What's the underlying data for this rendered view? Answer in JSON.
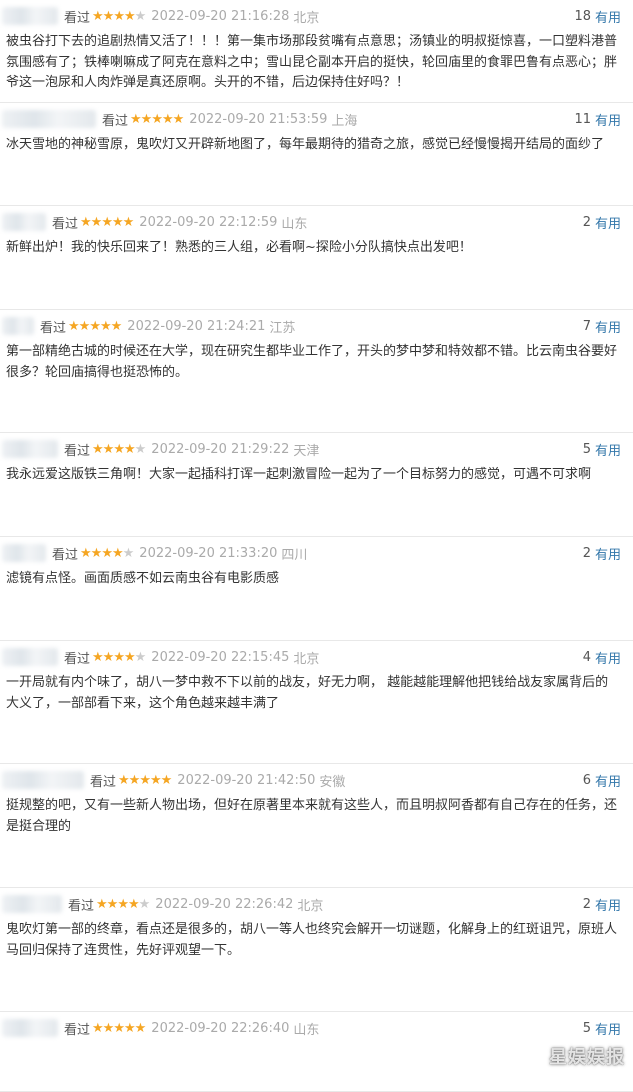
{
  "reviews": [
    {
      "watched": "看过",
      "rating": 4,
      "date": "2022-09-20 21:16:28",
      "location": "北京",
      "useful_count": "18",
      "useful_label": "有用",
      "text": "被虫谷打下去的追剧热情又活了！！！第一集市场那段贫嘴有点意思；汤镇业的明叔挺惊喜，一口塑料港普氛围感有了；铁棒喇嘛成了阿克在意料之中；雪山昆仑副本开启的挺快，轮回庙里的食罪巴鲁有点恶心；胖爷这一泡尿和人肉炸弹是真还原啊。头开的不错，后边保持住好吗？！"
    },
    {
      "watched": "看过",
      "rating": 5,
      "date": "2022-09-20 21:53:59",
      "location": "上海",
      "useful_count": "11",
      "useful_label": "有用",
      "text": "冰天雪地的神秘雪原，鬼吹灯又开辟新地图了，每年最期待的猎奇之旅，感觉已经慢慢揭开结局的面纱了"
    },
    {
      "watched": "看过",
      "rating": 5,
      "date": "2022-09-20 22:12:59",
      "location": "山东",
      "useful_count": "2",
      "useful_label": "有用",
      "text": "新鲜出炉！我的快乐回来了！熟悉的三人组，必看啊~探险小分队搞快点出发吧！"
    },
    {
      "watched": "看过",
      "rating": 5,
      "date": "2022-09-20 21:24:21",
      "location": "江苏",
      "useful_count": "7",
      "useful_label": "有用",
      "text": "第一部精绝古城的时候还在大学，现在研究生都毕业工作了，开头的梦中梦和特效都不错。比云南虫谷要好很多？轮回庙搞得也挺恐怖的。"
    },
    {
      "watched": "看过",
      "rating": 4,
      "date": "2022-09-20 21:29:22",
      "location": "天津",
      "useful_count": "5",
      "useful_label": "有用",
      "text": "我永远爱这版铁三角啊！大家一起插科打诨一起刺激冒险一起为了一个目标努力的感觉，可遇不可求啊"
    },
    {
      "watched": "看过",
      "rating": 4,
      "date": "2022-09-20 21:33:20",
      "location": "四川",
      "useful_count": "2",
      "useful_label": "有用",
      "text": "滤镜有点怪。画面质感不如云南虫谷有电影质感"
    },
    {
      "watched": "看过",
      "rating": 4,
      "date": "2022-09-20 22:15:45",
      "location": "北京",
      "useful_count": "4",
      "useful_label": "有用",
      "text": "一开局就有内个味了，胡八一梦中救不下以前的战友，好无力啊， 越能越能理解他把钱给战友家属背后的大义了，一部部看下来，这个角色越来越丰满了"
    },
    {
      "watched": "看过",
      "rating": 5,
      "date": "2022-09-20 21:42:50",
      "location": "安徽",
      "useful_count": "6",
      "useful_label": "有用",
      "text": "挺规整的吧，又有一些新人物出场，但好在原著里本来就有这些人，而且明叔阿香都有自己存在的任务，还是挺合理的"
    },
    {
      "watched": "看过",
      "rating": 4,
      "date": "2022-09-20 22:26:42",
      "location": "北京",
      "useful_count": "2",
      "useful_label": "有用",
      "text": "鬼吹灯第一部的终章，看点还是很多的，胡八一等人也终究会解开一切谜题，化解身上的红斑诅咒，原班人马回归保持了连贯性，先好评观望一下。"
    },
    {
      "watched": "看过",
      "rating": 5,
      "date": "2022-09-20 22:26:40",
      "location": "山东",
      "useful_count": "5",
      "useful_label": "有用",
      "text": ""
    }
  ],
  "watermark": "星娱娱报",
  "colors": {
    "star": "#f5a623",
    "star_off": "#cccccc",
    "useful_link": "#3377aa",
    "meta_gray": "#aaaaaa",
    "text": "#333333"
  }
}
